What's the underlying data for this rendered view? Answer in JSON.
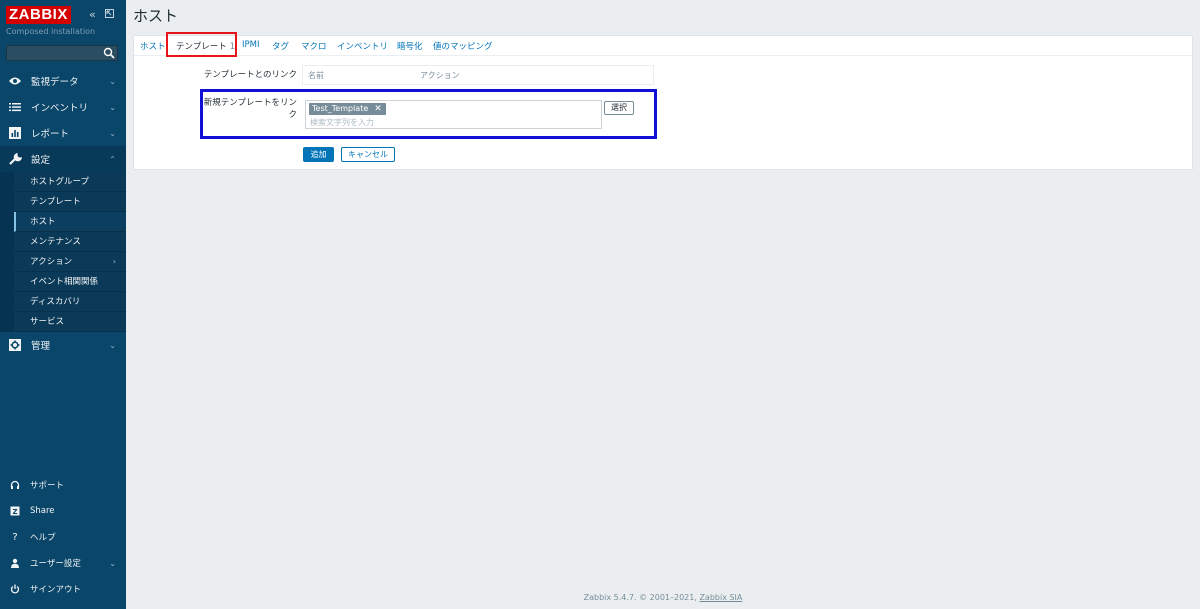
{
  "brand": {
    "logo": "ZABBIX",
    "subtitle": "Composed installation"
  },
  "sidebar": {
    "search_placeholder": "",
    "menu": [
      {
        "label": "監視データ",
        "icon": "eye-icon"
      },
      {
        "label": "インベントリ",
        "icon": "list-icon"
      },
      {
        "label": "レポート",
        "icon": "report-icon"
      },
      {
        "label": "設定",
        "icon": "wrench-icon"
      },
      {
        "label": "管理",
        "icon": "gear-icon"
      }
    ],
    "config_submenu": [
      "ホストグループ",
      "テンプレート",
      "ホスト",
      "メンテナンス",
      "アクション",
      "イベント相関関係",
      "ディスカバリ",
      "サービス"
    ],
    "bottom": [
      {
        "label": "サポート",
        "icon": "headset-icon"
      },
      {
        "label": "Share",
        "icon": "share-icon"
      },
      {
        "label": "ヘルプ",
        "icon": "help-icon"
      },
      {
        "label": "ユーザー設定",
        "icon": "user-icon"
      },
      {
        "label": "サインアウト",
        "icon": "power-icon"
      }
    ]
  },
  "page": {
    "title": "ホスト"
  },
  "tabs": {
    "host": "ホスト",
    "templates": "テンプレート",
    "templates_count": "1",
    "ipmi": "IPMI",
    "tags": "タグ",
    "macros": "マクロ",
    "inventory": "インベントリ",
    "encryption": "暗号化",
    "value_mapping": "値のマッピング"
  },
  "form": {
    "linked_templates_label": "テンプレートとのリンク",
    "col_name": "名前",
    "col_action": "アクション",
    "link_new_label": "新規テンプレートをリンク",
    "selected_template": "Test_Template",
    "search_placeholder": "検索文字列を入力",
    "select_button": "選択",
    "add_button": "追加",
    "cancel_button": "キャンセル"
  },
  "footer": {
    "text": "Zabbix 5.4.7. © 2001–2021, ",
    "link": "Zabbix SIA"
  },
  "colors": {
    "sidebar": "#0a466a",
    "logo": "#d40000",
    "link": "#0275b8",
    "highlight_red": "#e8141b",
    "highlight_blue": "#0f0fd6"
  }
}
